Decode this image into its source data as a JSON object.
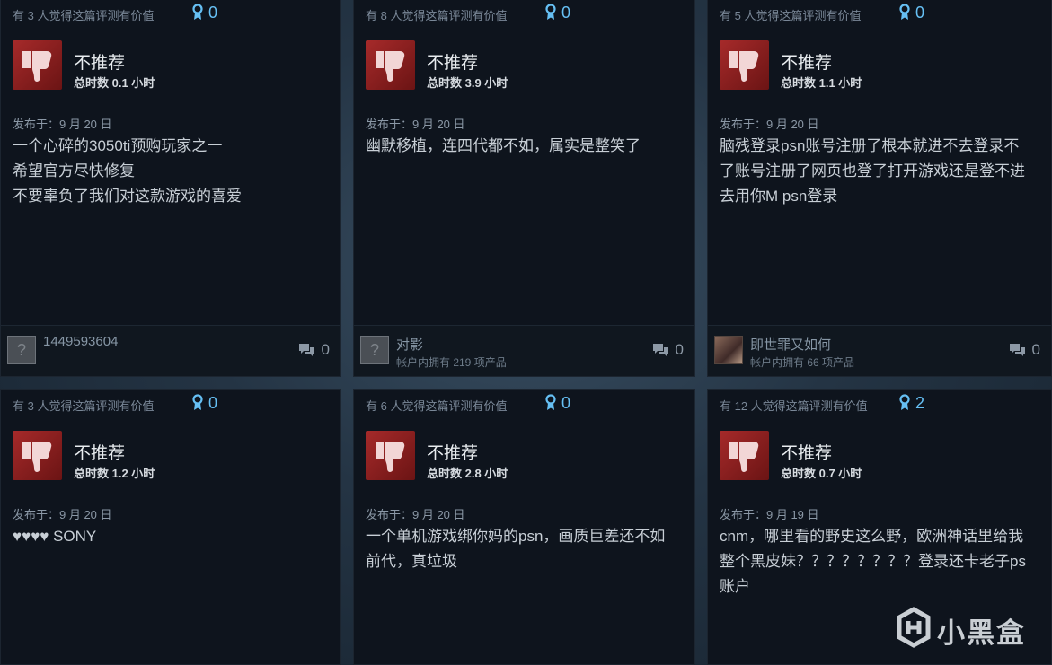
{
  "reviews": [
    {
      "helpful_text": "有 3 人觉得这篇评测有价值",
      "award_count": "0",
      "recommendation": "不推荐",
      "hours": "总时数 0.1 小时",
      "posted": "发布于：9 月 20 日",
      "lines": [
        "一个心碎的3050ti预购玩家之一",
        "希望官方尽快修复",
        "不要辜负了我们对这款游戏的喜爱"
      ],
      "username": "1449593604",
      "products": "",
      "comments": "0",
      "avatar": "?"
    },
    {
      "helpful_text": "有 8 人觉得这篇评测有价值",
      "award_count": "0",
      "recommendation": "不推荐",
      "hours": "总时数 3.9 小时",
      "posted": "发布于：9 月 20 日",
      "lines": [
        "幽默移植，连四代都不如，属实是整笑了"
      ],
      "username": "对影",
      "products": "帐户内拥有 219 项产品",
      "comments": "0",
      "avatar": "?"
    },
    {
      "helpful_text": "有 5 人觉得这篇评测有价值",
      "award_count": "0",
      "recommendation": "不推荐",
      "hours": "总时数 1.1 小时",
      "posted": "发布于：9 月 20 日",
      "lines": [
        "脑残登录psn账号注册了根本就进不去登录不",
        "了账号注册了网页也登了打开游戏还是登不进",
        "去用你M psn登录"
      ],
      "username": "即世罪又如何",
      "products": "帐户内拥有 66 项产品",
      "comments": "0",
      "avatar": ""
    },
    {
      "helpful_text": "有 3 人觉得这篇评测有价值",
      "award_count": "0",
      "recommendation": "不推荐",
      "hours": "总时数 1.2 小时",
      "posted": "发布于：9 月 20 日",
      "lines": [
        "♥♥♥♥ SONY"
      ]
    },
    {
      "helpful_text": "有 6 人觉得这篇评测有价值",
      "award_count": "0",
      "recommendation": "不推荐",
      "hours": "总时数 2.8 小时",
      "posted": "发布于：9 月 20 日",
      "lines": [
        "一个单机游戏绑你妈的psn，画质巨差还不如",
        "前代，真垃圾"
      ]
    },
    {
      "helpful_text": "有 12 人觉得这篇评测有价值",
      "award_count": "2",
      "recommendation": "不推荐",
      "hours": "总时数 0.7 小时",
      "posted": "发布于：9 月 19 日",
      "lines": [
        "cnm，哪里看的野史这么野，欧洲神话里给我",
        "整个黑皮妹？？？？？？？？登录还卡老子ps",
        "账户"
      ]
    }
  ],
  "watermark": "小黑盒",
  "colors": {
    "accent": "#66c0f4",
    "thumbs_down": "#a62a2a",
    "card_bg": "#0e141d"
  }
}
